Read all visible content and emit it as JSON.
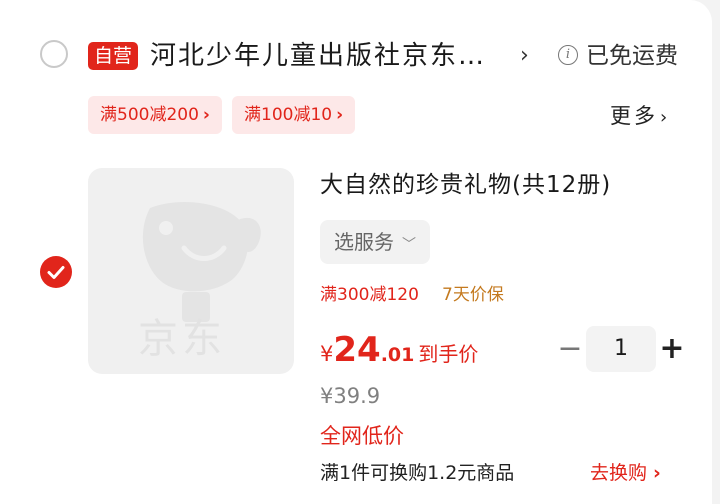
{
  "shop": {
    "badge": "自营",
    "name": "河北少年儿童出版社京东自营旗舰店",
    "arrow_icon": "chevron-right-icon",
    "shipping_icon": "info-icon",
    "shipping_text": "已免运费"
  },
  "coupons": [
    {
      "label": "满500减200"
    },
    {
      "label": "满100减10"
    }
  ],
  "more_label": "更多",
  "product": {
    "checked": true,
    "image_logo_text": "京东",
    "title": "大自然的珍贵礼物(共12册)",
    "service_label": "选服务",
    "promo_discount": "满300减120",
    "promo_guarantee": "7天价保",
    "price_symbol": "¥",
    "price_int": "24",
    "price_dec": ".01",
    "price_label": "到手价",
    "quantity": "1",
    "original_price": "¥39.9",
    "lowest_label": "全网低价",
    "exchange_text": "满1件可换购1.2元商品",
    "exchange_link": "去换购"
  },
  "colors": {
    "accent": "#e1251b",
    "coupon_bg": "#fde8e8",
    "guarantee": "#c47a1f"
  }
}
